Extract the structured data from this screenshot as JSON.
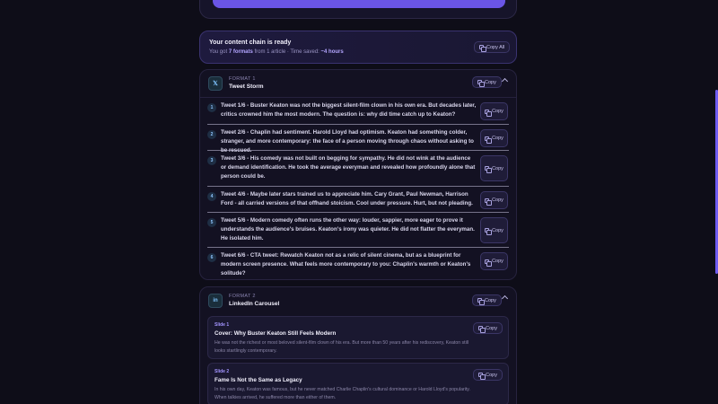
{
  "banner": {
    "title": "Your content chain is ready",
    "sub_prefix": "You got ",
    "formats_count": "7 formats",
    "sub_mid": " from 1 article · Time saved: ",
    "time_saved": "~4 hours",
    "copy_all_label": "Copy All"
  },
  "copy_label": "Copy",
  "formats": [
    {
      "label": "FORMAT 1",
      "name": "Tweet Storm",
      "icon": "x-logo-icon",
      "icon_text": "𝕏",
      "tweets": [
        {
          "num": "1",
          "text": "Tweet 1/6 - Buster Keaton was not the biggest silent-film clown in his own era. But decades later, critics crowned him the most modern. The question is: why did time catch up to Keaton?"
        },
        {
          "num": "2",
          "text": "Tweet 2/6 - Chaplin had sentiment. Harold Lloyd had optimism. Keaton had something colder, stranger, and more contemporary: the face of a person moving through chaos without asking to be rescued."
        },
        {
          "num": "3",
          "text": "Tweet 3/6 - His comedy was not built on begging for sympathy. He did not wink at the audience or demand identification. He took the average everyman and revealed how profoundly alone that person could be."
        },
        {
          "num": "4",
          "text": "Tweet 4/6 - Maybe later stars trained us to appreciate him. Cary Grant, Paul Newman, Harrison Ford - all carried versions of that offhand stoicism. Cool under pressure. Hurt, but not pleading."
        },
        {
          "num": "5",
          "text": "Tweet 5/6 - Modern comedy often runs the other way: louder, sappier, more eager to prove it understands the audience's bruises. Keaton's irony was quieter. He did not flatter the everyman. He isolated him."
        },
        {
          "num": "6",
          "text": "Tweet 6/6 - CTA tweet: Rewatch Keaton not as a relic of silent cinema, but as a blueprint for modern screen presence. What feels more contemporary to you: Chaplin's warmth or Keaton's solitude?"
        }
      ]
    },
    {
      "label": "FORMAT 2",
      "name": "LinkedIn Carousel",
      "icon": "linkedin-icon",
      "icon_text": "in",
      "slides": [
        {
          "label": "Slide 1",
          "title": "Cover: Why Buster Keaton Still Feels Modern",
          "body": "He was not the richest or most beloved silent-film clown of his era. But more than 50 years after his rediscovery, Keaton still looks startlingly contemporary."
        },
        {
          "label": "Slide 2",
          "title": "Fame Is Not the Same as Legacy",
          "body": "In his own day, Keaton was famous, but he never matched Charlie Chaplin's cultural dominance or Harold Lloyd's popularity. When talkies arrived, he suffered more than either of them."
        }
      ]
    }
  ]
}
